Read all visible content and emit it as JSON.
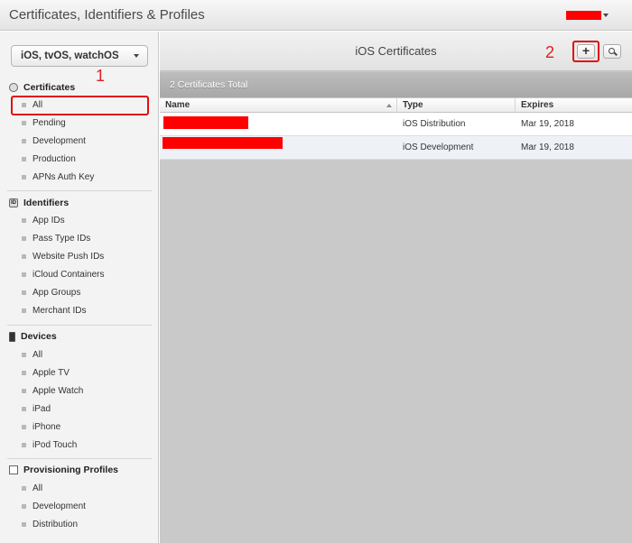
{
  "header": {
    "title": "Certificates, Identifiers & Profiles"
  },
  "colors": {
    "annotation": "#e01010",
    "redaction": "#ff0000"
  },
  "annotations": {
    "one": "1",
    "two": "2"
  },
  "sidebar": {
    "platform_select": "iOS, tvOS, watchOS",
    "sections": {
      "certificates": {
        "title": "Certificates",
        "items": [
          "All",
          "Pending",
          "Development",
          "Production",
          "APNs Auth Key"
        ]
      },
      "identifiers": {
        "title": "Identifiers",
        "items": [
          "App IDs",
          "Pass Type IDs",
          "Website Push IDs",
          "iCloud Containers",
          "App Groups",
          "Merchant IDs"
        ]
      },
      "devices": {
        "title": "Devices",
        "items": [
          "All",
          "Apple TV",
          "Apple Watch",
          "iPad",
          "iPhone",
          "iPod Touch"
        ]
      },
      "profiles": {
        "title": "Provisioning Profiles",
        "items": [
          "All",
          "Development",
          "Distribution"
        ]
      }
    },
    "selected": "certificates.All"
  },
  "main": {
    "title": "iOS Certificates",
    "add_label": "+",
    "total": "2 Certificates Total",
    "columns": {
      "name": "Name",
      "type": "Type",
      "expires": "Expires"
    },
    "rows": [
      {
        "type": "iOS Distribution",
        "expires": "Mar 19, 2018"
      },
      {
        "type": "iOS Development",
        "expires": "Mar 19, 2018"
      }
    ]
  }
}
